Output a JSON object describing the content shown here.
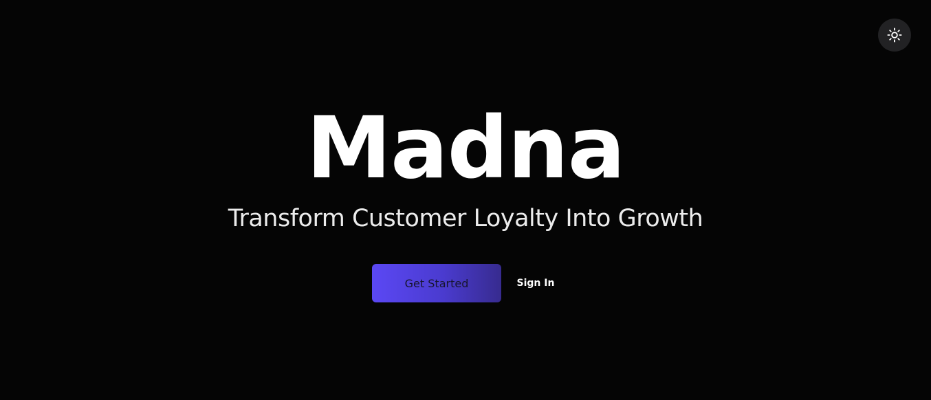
{
  "header": {
    "theme_toggle": {
      "icon": "sun-icon",
      "icon_color": "#ffffff",
      "background": "#222224"
    }
  },
  "hero": {
    "title": "Madna",
    "tagline": "Transform Customer Loyalty Into Growth"
  },
  "actions": {
    "get_started_label": "Get Started",
    "sign_in_label": "Sign In"
  },
  "colors": {
    "background": "#050505",
    "accent_start": "#5b48f4",
    "accent_end": "#372b8f",
    "text": "#ffffff"
  }
}
